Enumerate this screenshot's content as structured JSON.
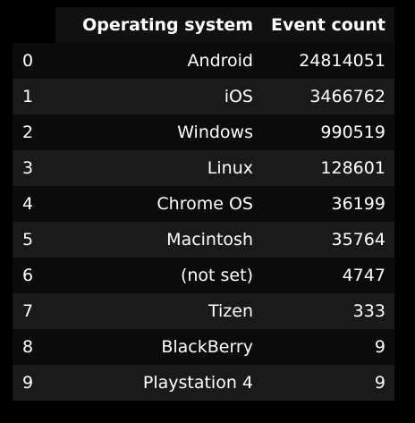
{
  "table": {
    "index_header": "",
    "columns": [
      "Operating system",
      "Event count"
    ],
    "rows": [
      {
        "index": "0",
        "os": "Android",
        "count": "24814051"
      },
      {
        "index": "1",
        "os": "iOS",
        "count": "3466762"
      },
      {
        "index": "2",
        "os": "Windows",
        "count": "990519"
      },
      {
        "index": "3",
        "os": "Linux",
        "count": "128601"
      },
      {
        "index": "4",
        "os": "Chrome OS",
        "count": "36199"
      },
      {
        "index": "5",
        "os": "Macintosh",
        "count": "35764"
      },
      {
        "index": "6",
        "os": "(not set)",
        "count": "4747"
      },
      {
        "index": "7",
        "os": "Tizen",
        "count": "333"
      },
      {
        "index": "8",
        "os": "BlackBerry",
        "count": "9"
      },
      {
        "index": "9",
        "os": "Playstation 4",
        "count": "9"
      }
    ]
  }
}
